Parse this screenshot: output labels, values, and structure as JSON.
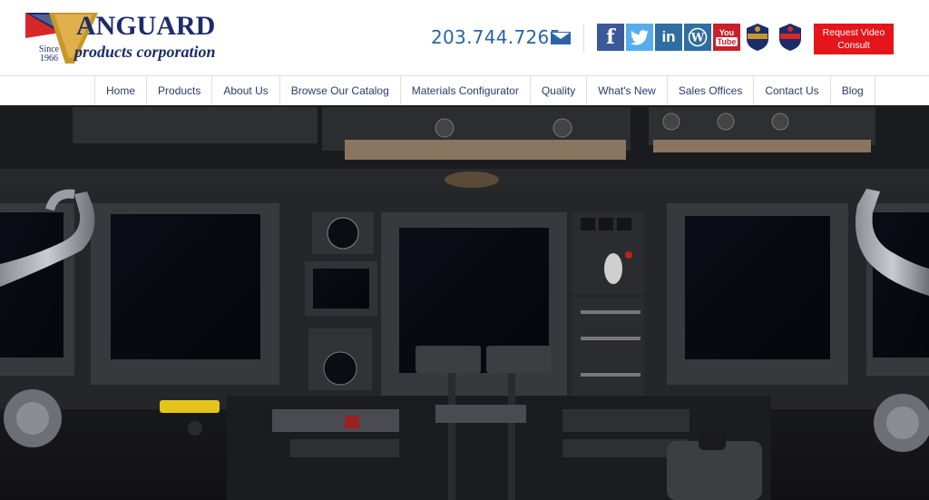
{
  "logo": {
    "name": "ANGUARD",
    "letter": "V",
    "since": "Since",
    "year": "1966",
    "sub": "products corporation"
  },
  "contact": {
    "phone": "203.744.7265",
    "mail_icon": "envelope-icon"
  },
  "social": {
    "facebook": "f",
    "twitter_icon": "twitter-bird-icon",
    "linkedin": "in",
    "wordpress_icon": "wordpress-icon",
    "youtube_top": "You",
    "youtube_bottom": "Tube"
  },
  "badges": [
    "quality-badge-icon",
    "certification-badge-icon"
  ],
  "cta": {
    "label": "Request Video Consult"
  },
  "nav": {
    "items": [
      "Home",
      "Products",
      "About Us",
      "Browse Our Catalog",
      "Materials Configurator",
      "Quality",
      "What's New",
      "Sales Offices",
      "Contact Us",
      "Blog"
    ]
  },
  "colors": {
    "brand_navy": "#1b2c6b",
    "link_blue": "#2a63a8",
    "cta_red": "#e4161b"
  }
}
